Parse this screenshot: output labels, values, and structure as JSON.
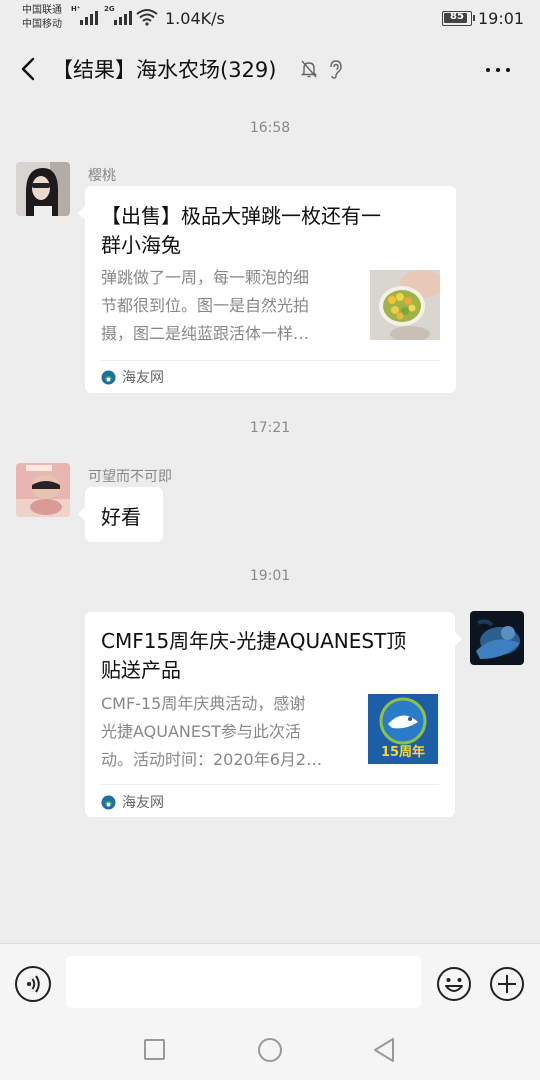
{
  "status_bar": {
    "carrier1": "中国联通",
    "carrier2": "中国移动",
    "net1": "H⁺",
    "net2": "2G",
    "speed": "1.04K/s",
    "battery": "85",
    "time": "19:01"
  },
  "header": {
    "title": "【结果】海水农场(329)",
    "icons": [
      "back-arrow-icon",
      "mute-bell-icon",
      "ear-icon",
      "more-icon"
    ]
  },
  "messages": [
    {
      "time": "16:58",
      "sender": "樱桃",
      "type": "link-card",
      "title_lines": [
        "【出售】极品大弹跳一枚还有一",
        "群小海兔"
      ],
      "desc_lines": [
        "弹跳做了一周，每一颗泡的细",
        "节都很到位。图一是自然光拍",
        "摄，图二是纯蓝跟活体一样…"
      ],
      "source": "海友网"
    },
    {
      "time": "17:21",
      "sender": "可望而不可即",
      "type": "text",
      "text": "好看"
    },
    {
      "time": "19:01",
      "sender": "",
      "type": "link-card",
      "title_lines": [
        "CMF15周年庆-光捷AQUANEST顶",
        "贴送产品"
      ],
      "desc_lines": [
        "CMF-15周年庆典活动，感谢",
        "光捷AQUANEST参与此次活",
        "动。活动时间：2020年6月2…"
      ],
      "source": "海友网",
      "thumb_text": "15周年"
    }
  ],
  "input_bar": {
    "value": "",
    "icons": [
      "voice-icon",
      "emoji-icon",
      "plus-icon"
    ]
  },
  "system_nav": [
    "recent-apps-icon",
    "home-icon",
    "back-icon"
  ],
  "colors": {
    "background": "#ededed",
    "bubble": "#ffffff",
    "time_text": "#8a8a8a",
    "source_icon": "#1f6f9f"
  }
}
